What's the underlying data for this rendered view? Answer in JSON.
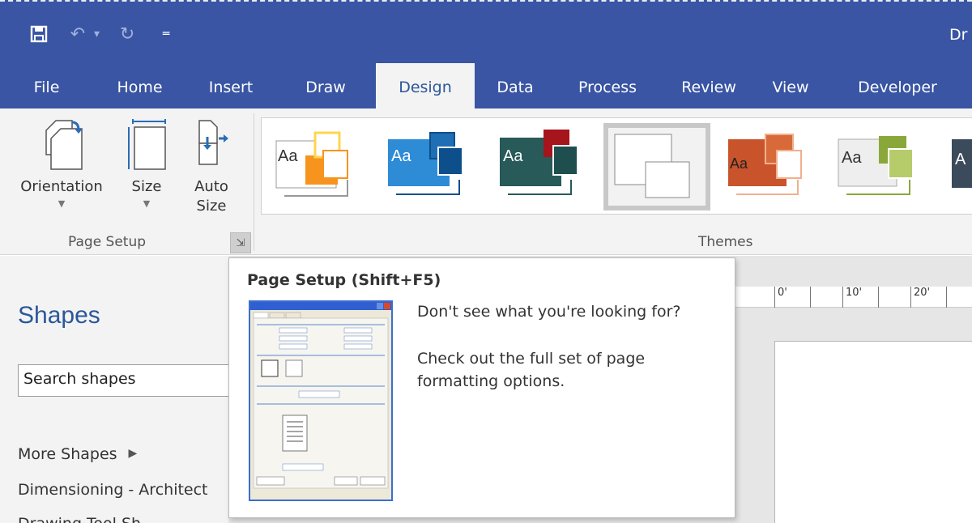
{
  "window": {
    "title": "Dr"
  },
  "quick_access": [
    {
      "icon": "save-icon"
    },
    {
      "icon": "undo-icon"
    },
    {
      "icon": "redo-icon"
    },
    {
      "icon": "customize-quick-access-icon"
    }
  ],
  "tabs": [
    {
      "label": "File",
      "active": false
    },
    {
      "label": "Home",
      "active": false
    },
    {
      "label": "Insert",
      "active": false
    },
    {
      "label": "Draw",
      "active": false
    },
    {
      "label": "Design",
      "active": true
    },
    {
      "label": "Data",
      "active": false
    },
    {
      "label": "Process",
      "active": false
    },
    {
      "label": "Review",
      "active": false
    },
    {
      "label": "View",
      "active": false
    },
    {
      "label": "Developer",
      "active": false
    }
  ],
  "page_setup": {
    "group_label": "Page Setup",
    "orientation_label": "Orientation",
    "size_label": "Size",
    "auto_size_line1": "Auto",
    "auto_size_line2": "Size"
  },
  "themes": {
    "group_label": "Themes",
    "items": [
      {
        "aa": "Aa",
        "accent": "#f7941d",
        "accent2": "#ffd54f",
        "bg": "#ffffff",
        "selected": false
      },
      {
        "aa": "Aa",
        "accent": "#1f6fb5",
        "accent2": "#0d4f8b",
        "bg": "#2e8bd6",
        "selected": false
      },
      {
        "aa": "Aa",
        "accent": "#a6141c",
        "accent2": "#1e4e4e",
        "bg": "#275a59",
        "selected": false
      },
      {
        "aa": "",
        "accent": "#ffffff",
        "accent2": "#ffffff",
        "bg": "#ffffff",
        "selected": true
      },
      {
        "aa": "Aa",
        "accent": "#d86a3a",
        "accent2": "#f0b08e",
        "bg": "#c9542b",
        "selected": false
      },
      {
        "aa": "Aa",
        "accent": "#8aa83a",
        "accent2": "#b6cc6b",
        "bg": "#eeeeee",
        "selected": false
      },
      {
        "aa": "A",
        "accent": "#3b4b5c",
        "accent2": "#3b4b5c",
        "bg": "#3b4b5c",
        "selected": false
      }
    ]
  },
  "shapes_panel": {
    "title": "Shapes",
    "search_value": "Search shapes",
    "more_shapes": "More Shapes",
    "stencils": [
      "Dimensioning - Architect",
      "Drawing Tool Sh"
    ]
  },
  "ruler": {
    "labels": [
      "0'",
      "10'",
      "20'"
    ]
  },
  "tooltip": {
    "title": "Page Setup (Shift+F5)",
    "line1": "Don't see what you're looking for?",
    "line2": "Check out the full set of page formatting options."
  }
}
